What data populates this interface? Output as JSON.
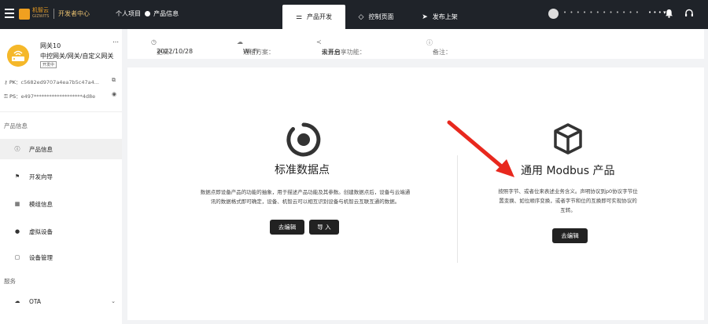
{
  "topbar": {
    "brand_cn": "机智云",
    "brand_en": "GIZWITS",
    "dev_center": "开发者中心",
    "crumb_project": "个人项目",
    "crumb_product": "产品信息",
    "tabs": [
      {
        "label": "产品开发",
        "icon": "sliders-icon"
      },
      {
        "label": "控制页面",
        "icon": "diamond-icon"
      },
      {
        "label": "发布上架",
        "icon": "send-icon"
      }
    ],
    "username": "• • • • • • • • • • • •",
    "org": "• • •"
  },
  "sidebar": {
    "gateway_name": "网关10",
    "gateway_type": "中控网关/网关/自定义网关",
    "badge": "开发中",
    "pk_label": "PK",
    "pk_value": "c5682ed9707a4ea7b5c47a4...",
    "ps_label": "PS",
    "ps_value": "e497*******************4d8e",
    "section_product": "产品信息",
    "section_service": "服务",
    "nav": [
      {
        "label": "产品信息",
        "icon": "info-icon"
      },
      {
        "label": "开发向导",
        "icon": "signpost-icon"
      },
      {
        "label": "模组信息",
        "icon": "grid-icon"
      },
      {
        "label": "虚拟设备",
        "icon": "globe-icon"
      },
      {
        "label": "设备管理",
        "icon": "clipboard-icon"
      },
      {
        "label": "OTA",
        "icon": "cloud-icon"
      }
    ]
  },
  "infobar": {
    "updated_label": "更新：",
    "updated_value": "2022/10/28",
    "comm_label": "通信方案：",
    "comm_value": "Wi-Fi",
    "share_label": "设备分享功能：",
    "share_value": "未开启",
    "note_label": "备注：",
    "note_value": "-"
  },
  "options": {
    "standard": {
      "title": "标准数据点",
      "desc1": "数据点即设备产品的功能的抽象，用于描述产品功能及其参数。创建数据点后，设备与云端通",
      "desc2": "讯的数据格式即可确定，设备、机智云可以相互识别设备与机智云互联互通的数据。",
      "edit": "去编辑",
      "import": "导 入"
    },
    "modbus": {
      "title": "通用 Modbus 产品",
      "desc1": "按照字节、或者位来表述业务含义。声明协议到p0协议字节位",
      "desc2": "置变换、如位顺序变换，或者字节和位的互换即可实现协议的",
      "desc3": "互转。",
      "edit": "去编辑"
    }
  },
  "colors": {
    "topbar": "#1f2329",
    "brand": "#f0a020",
    "button": "#222222",
    "arrow": "#e8281e"
  }
}
